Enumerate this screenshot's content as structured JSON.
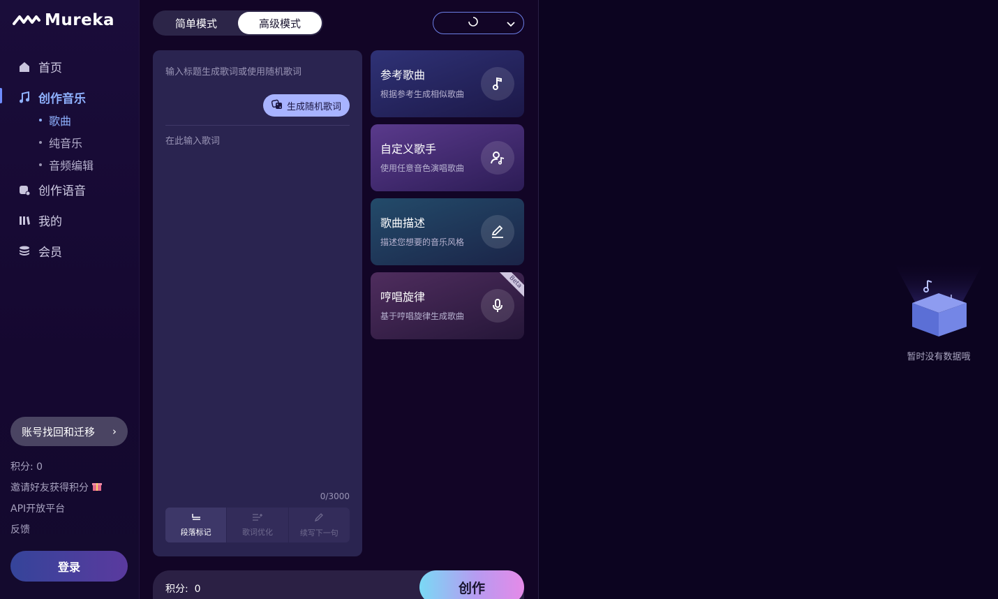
{
  "brand": {
    "name": "Mureka"
  },
  "nav": {
    "home": "首页",
    "create_music": "创作音乐",
    "sub": {
      "song": "歌曲",
      "pure_music": "纯音乐",
      "audio_edit": "音频编辑"
    },
    "create_voice": "创作语音",
    "mine": "我的",
    "member": "会员"
  },
  "sidebar_footer": {
    "account_btn": "账号找回和迁移",
    "account_arrow": "›",
    "credits": "积分: 0",
    "invite": "邀请好友获得积分",
    "api": "API开放平台",
    "feedback": "反馈",
    "login": "登录"
  },
  "mode": {
    "simple": "简单模式",
    "advanced": "高级模式",
    "selected": "advanced"
  },
  "lyrics": {
    "title_placeholder": "输入标题生成歌词或使用随机歌词",
    "random_btn": "生成随机歌词",
    "lyrics_placeholder": "在此输入歌词",
    "count": "0/3000",
    "tools": [
      {
        "label": "段落标记",
        "active": true
      },
      {
        "label": "歌词优化",
        "active": false
      },
      {
        "label": "续写下一句",
        "active": false
      }
    ]
  },
  "cards": [
    {
      "title": "参考歌曲",
      "desc": "根据参考生成相似歌曲",
      "icon": "music-note-icon"
    },
    {
      "title": "自定义歌手",
      "desc": "使用任意音色演唱歌曲",
      "icon": "singer-icon"
    },
    {
      "title": "歌曲描述",
      "desc": "描述您想要的音乐风格",
      "icon": "pen-icon"
    },
    {
      "title": "哼唱旋律",
      "desc": "基于哼唱旋律生成歌曲",
      "icon": "mic-icon",
      "badge": "Beta"
    }
  ],
  "bottom": {
    "credits_label": "积分:",
    "credits_value": "0",
    "create_btn": "创作"
  },
  "empty_state": {
    "text": "暂时没有数据哦"
  },
  "colors": {
    "accent": "#8fb2ff",
    "panel": "#2a2450",
    "bg": "#120526"
  }
}
